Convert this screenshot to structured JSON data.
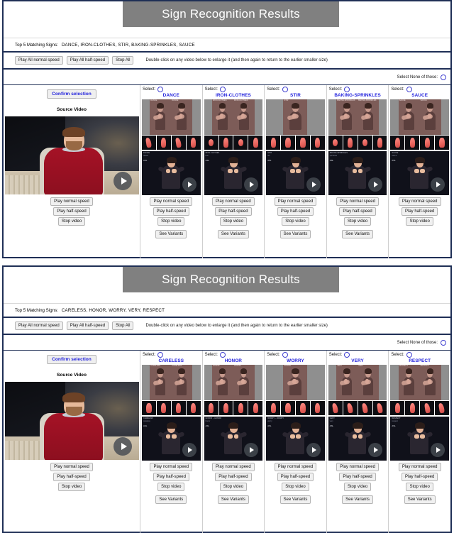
{
  "panels": [
    {
      "title": "Sign Recognition Results",
      "top5_label": "Top 5 Matching Signs:",
      "top5_list": "DANCE,  IRON-CLOTHES,  STIR,  BAKING-SPRINKLES,  SAUCE",
      "controls": {
        "play_all_normal": "Play All normal speed",
        "play_all_half": "Play All half-speed",
        "stop_all": "Stop All",
        "hint": "Double-click on any video below to enlarge it (and then again to return to the earlier smaller size)"
      },
      "select_none_label": "Select None of those:",
      "source": {
        "confirm_label": "Confirm selection",
        "heading": "Source Video",
        "play_normal": "Play normal speed",
        "play_half": "Play half-speed",
        "stop": "Stop video"
      },
      "candidates": [
        {
          "select_label": "Select:",
          "gloss": "DANCE",
          "still_label": "DANCE",
          "video_meta_1": "DANCE",
          "video_meta_2": "dance",
          "video_meta_3": "ASL",
          "play_normal": "Play normal speed",
          "play_half": "Play half-speed",
          "stop": "Stop video",
          "variants": "See Variants"
        },
        {
          "select_label": "Select:",
          "gloss": "IRON-CLOTHES",
          "still_label": "IRON-CLOTHES",
          "video_meta_1": "IRON-CLOTHES",
          "video_meta_2": "iron",
          "video_meta_3": "ASL",
          "play_normal": "Play normal speed",
          "play_half": "Play half-speed",
          "stop": "Stop video",
          "variants": "See Variants"
        },
        {
          "select_label": "Select:",
          "gloss": "STIR",
          "still_label": "STIR",
          "video_meta_1": "STIR",
          "video_meta_2": "stir",
          "video_meta_3": "ASL",
          "play_normal": "Play normal speed",
          "play_half": "Play half-speed",
          "stop": "Stop video",
          "variants": "See Variants"
        },
        {
          "select_label": "Select:",
          "gloss": "BAKING-SPRINKLES",
          "still_label": "BAKING-SPRINKLES",
          "video_meta_1": "BAKING-SPRINKLES",
          "video_meta_2": "sprinkles",
          "video_meta_3": "ASL",
          "play_normal": "Play normal speed",
          "play_half": "Play half-speed",
          "stop": "Stop video",
          "variants": "See Variants"
        },
        {
          "select_label": "Select:",
          "gloss": "SAUCE",
          "still_label": "SAUCE",
          "video_meta_1": "SAUCE",
          "video_meta_2": "sauce",
          "video_meta_3": "ASL",
          "play_normal": "Play normal speed",
          "play_half": "Play half-speed",
          "stop": "Stop video",
          "variants": "See Variants"
        }
      ]
    },
    {
      "title": "Sign Recognition Results",
      "top5_label": "Top 5 Matching Signs:",
      "top5_list": "CARELESS,  HONOR,  WORRY,  VERY,  RESPECT",
      "controls": {
        "play_all_normal": "Play All normal speed",
        "play_all_half": "Play All half-speed",
        "stop_all": "Stop All",
        "hint": "Double-click on any video below to enlarge it (and then again to return to the earlier smaller size)"
      },
      "select_none_label": "Select None of those:",
      "source": {
        "confirm_label": "Confirm selection",
        "heading": "Source Video",
        "play_normal": "Play normal speed",
        "play_half": "Play half-speed",
        "stop": "Stop video"
      },
      "candidates": [
        {
          "select_label": "Select:",
          "gloss": "CARELESS",
          "still_label": "CARELESS",
          "video_meta_1": "CARELESS",
          "video_meta_2": "careless",
          "video_meta_3": "ASL",
          "play_normal": "Play normal speed",
          "play_half": "Play half-speed",
          "stop": "Stop video",
          "variants": "See Variants"
        },
        {
          "select_label": "Select:",
          "gloss": "HONOR",
          "still_label": "HONOR",
          "video_meta_1": "HONOR -- HONOR",
          "video_meta_2": "honor",
          "video_meta_3": "ASL",
          "play_normal": "Play normal speed",
          "play_half": "Play half-speed",
          "stop": "Stop video",
          "variants": "See Variants"
        },
        {
          "select_label": "Select:",
          "gloss": "WORRY",
          "still_label": "WORRY",
          "video_meta_1": "WORRY -- WORRY",
          "video_meta_2": "worry",
          "video_meta_3": "ASL",
          "play_normal": "Play normal speed",
          "play_half": "Play half-speed",
          "stop": "Stop video",
          "variants": "See Variants"
        },
        {
          "select_label": "Select:",
          "gloss": "VERY",
          "still_label": "VERY",
          "video_meta_1": "VERY",
          "video_meta_2": "very",
          "video_meta_3": "ASL",
          "play_normal": "Play normal speed",
          "play_half": "Play half-speed",
          "stop": "Stop video",
          "variants": "See Variants"
        },
        {
          "select_label": "Select:",
          "gloss": "RESPECT",
          "still_label": "RESPECT",
          "video_meta_1": "RESPECT",
          "video_meta_2": "respect",
          "video_meta_3": "ASL",
          "play_normal": "Play normal speed",
          "play_half": "Play half-speed",
          "stop": "Stop video",
          "variants": "See Variants"
        }
      ]
    }
  ]
}
